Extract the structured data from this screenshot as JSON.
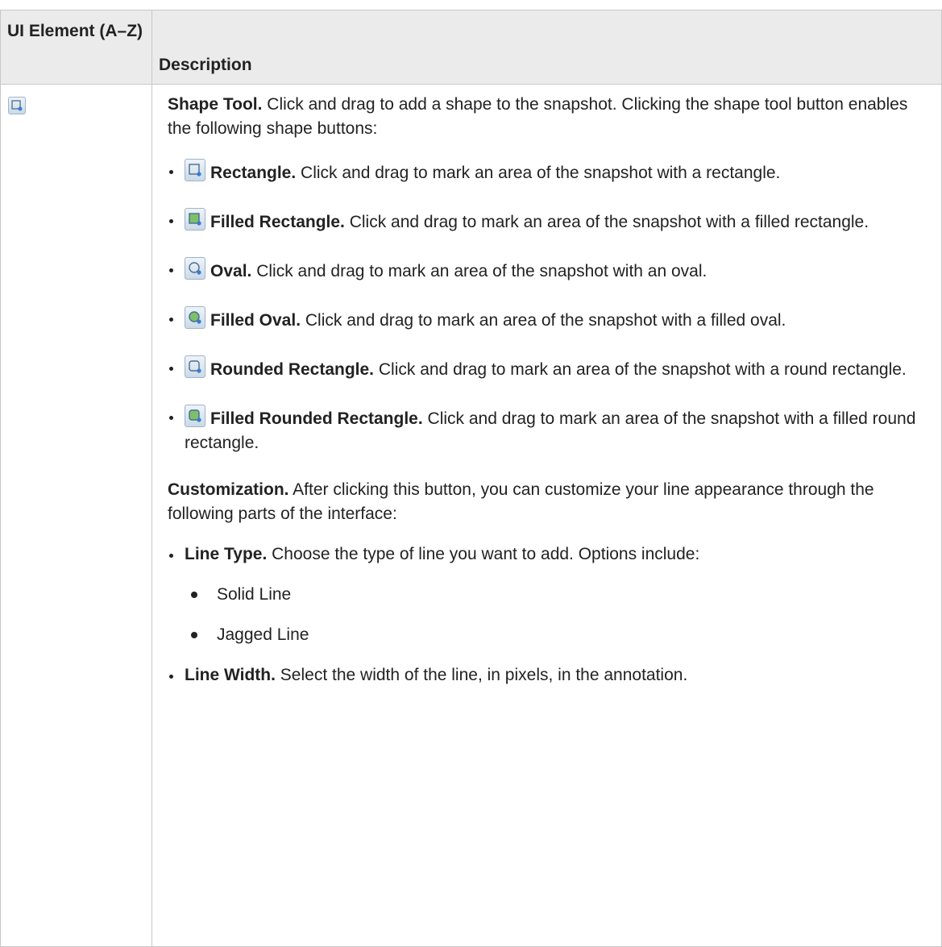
{
  "headers": {
    "col1": "UI Element (A–Z)",
    "col2": "Description"
  },
  "shape_tool": {
    "icon": "shape-tool-icon",
    "title": "Shape Tool.",
    "text": " Click and drag to add a shape to the snapshot. Clicking the shape tool button enables the following shape buttons:"
  },
  "shapes": [
    {
      "icon": "rectangle-icon",
      "title": "Rectangle.",
      "text": " Click and drag to mark an area of the snapshot with a rectangle."
    },
    {
      "icon": "filled-rectangle-icon",
      "title": "Filled Rectangle.",
      "text": " Click and drag to mark an area of the snapshot with a filled rectangle."
    },
    {
      "icon": "oval-icon",
      "title": "Oval.",
      "text": " Click and drag to mark an area of the snapshot with an oval."
    },
    {
      "icon": "filled-oval-icon",
      "title": "Filled Oval.",
      "text": " Click and drag to mark an area of the snapshot with a filled oval."
    },
    {
      "icon": "rounded-rectangle-icon",
      "title": "Rounded Rectangle.",
      "text": " Click and drag to mark an area of the snapshot with a round rectangle."
    },
    {
      "icon": "filled-rounded-rectangle-icon",
      "title": "Filled Rounded Rectangle.",
      "text": " Click and drag to mark an area of the snapshot with a filled round rectangle."
    }
  ],
  "customization": {
    "title": "Customization.",
    "text": " After clicking this button, you can customize your line appearance through the following parts of the interface:"
  },
  "line_type": {
    "title": "Line Type.",
    "text": " Choose the type of line you want to add. Options include:"
  },
  "line_type_options": [
    "Solid Line",
    "Jagged Line"
  ],
  "line_width": {
    "title": "Line Width.",
    "text": " Select the width of the line, in pixels, in the annotation."
  }
}
